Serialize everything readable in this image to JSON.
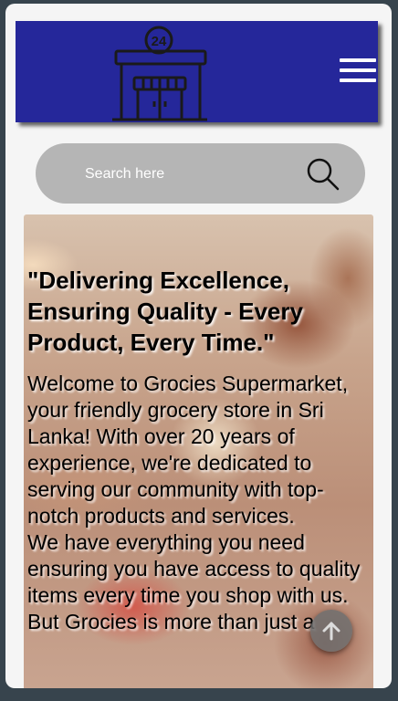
{
  "header": {
    "logo_icon": "store-24-hours-icon",
    "logo_badge": "24",
    "menu_icon": "hamburger-menu-icon"
  },
  "search": {
    "placeholder": "Search here",
    "icon": "search-icon"
  },
  "hero": {
    "title": "\"Delivering Excellence, Ensuring Quality - Every Product, Every Time.\"",
    "paragraphs": [
      "Welcome to Grocies Supermarket, your friendly grocery store in Sri Lanka! With over 20 years of experience, we're dedicated to serving our community with top-notch products and services.",
      "We have everything you need ensuring you have access to quality items every time you shop with us.",
      "But Grocies is more than just a"
    ]
  },
  "scroll_top": {
    "icon": "arrow-up-icon"
  },
  "colors": {
    "header_bg": "#25279a",
    "page_bg": "#37444d",
    "search_bg": "#b5b5b5"
  }
}
